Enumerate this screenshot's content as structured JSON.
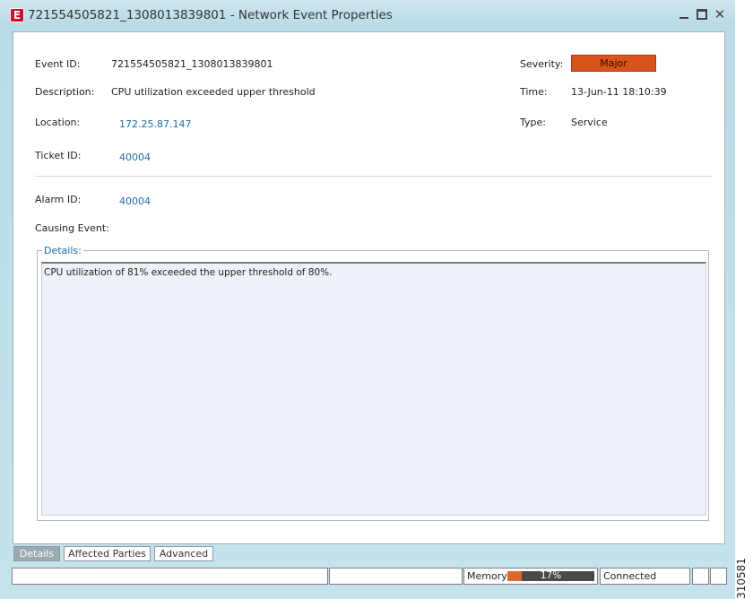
{
  "window": {
    "title": "721554505821_1308013839801 - Network Event Properties",
    "app_icon_letter": "E",
    "close_glyph": "✕"
  },
  "fields": {
    "event_id_label": "Event ID:",
    "event_id_value": "721554505821_1308013839801",
    "description_label": "Description:",
    "description_value": "CPU utilization exceeded upper threshold",
    "location_label": "Location:",
    "location_value": "172.25.87.147",
    "ticket_id_label": "Ticket ID:",
    "ticket_id_value": "40004",
    "severity_label": "Severity:",
    "severity_value": "Major",
    "time_label": "Time:",
    "time_value": "13-Jun-11 18:10:39",
    "type_label": "Type:",
    "type_value": "Service",
    "alarm_id_label": "Alarm ID:",
    "alarm_id_value": "40004",
    "causing_event_label": "Causing Event:"
  },
  "colors": {
    "severity_major": "#d9531b",
    "link": "#1a6da6",
    "memory_fill": "#d96a2b"
  },
  "details": {
    "legend": "Details:",
    "text": "CPU utilization of 81% exceeded the upper threshold of 80%."
  },
  "tabs": [
    {
      "label": "Details",
      "active": true
    },
    {
      "label": "Affected Parties",
      "active": false
    },
    {
      "label": "Advanced",
      "active": false
    }
  ],
  "status": {
    "memory_label": "Memory:",
    "memory_percent": 17,
    "memory_text": "17%",
    "connection": "Connected"
  },
  "figure_id": "310581"
}
